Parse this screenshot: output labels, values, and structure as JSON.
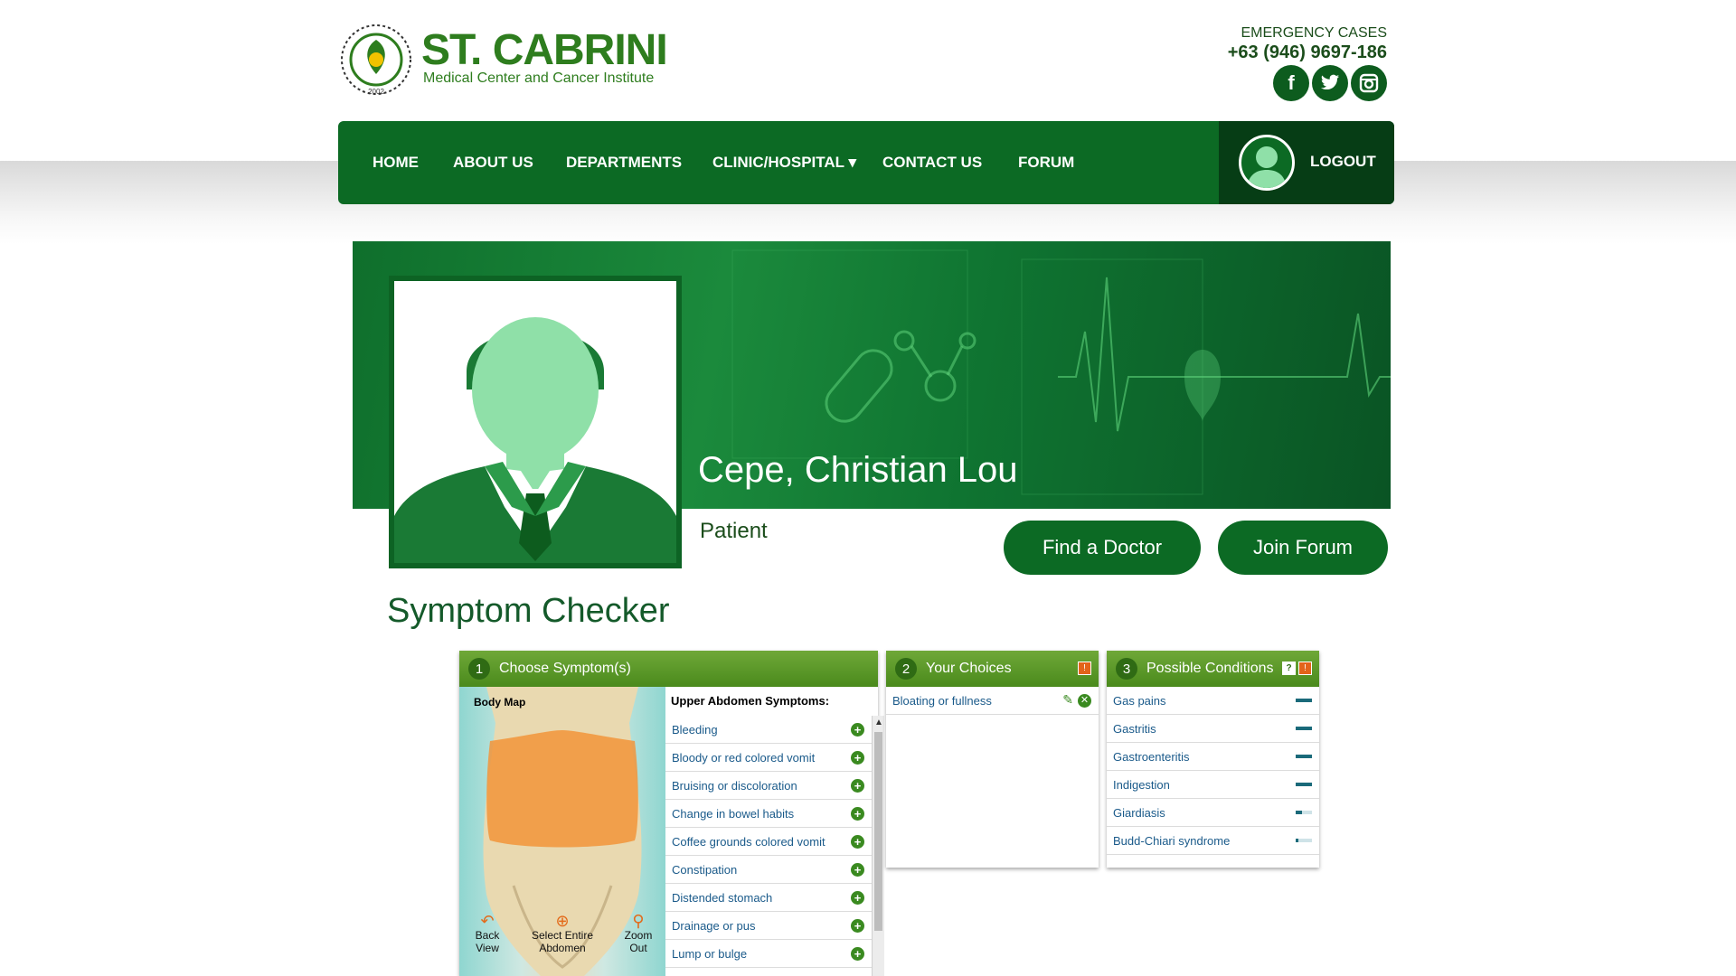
{
  "brand": {
    "name": "ST. CABRINI",
    "subtitle": "Medical Center and Cancer Institute",
    "logo_year": "2002"
  },
  "emergency": {
    "label": "EMERGENCY CASES",
    "phone": "+63 (946) 9697-186"
  },
  "social": [
    {
      "icon": "facebook-icon",
      "glyph": "f"
    },
    {
      "icon": "twitter-icon",
      "glyph": "t"
    },
    {
      "icon": "instagram-icon",
      "glyph": "◎"
    }
  ],
  "nav": {
    "items": [
      "HOME",
      "ABOUT US",
      "DEPARTMENTS",
      "CLINIC/HOSPITAL",
      "CONTACT US",
      "FORUM"
    ],
    "dropdown_caret": "▾",
    "logout": "LOGOUT"
  },
  "profile": {
    "name": "Cepe, Christian Lou",
    "role": "Patient"
  },
  "buttons": {
    "find_doctor": "Find a Doctor",
    "join_forum": "Join Forum"
  },
  "checker": {
    "title": "Symptom Checker",
    "step1": {
      "num": "1",
      "label": "Choose Symptom(s)",
      "bodymap_label": "Body Map",
      "controls": [
        "Back View",
        "Select Entire Abdomen",
        "Zoom Out"
      ],
      "list_title": "Upper Abdomen Symptoms:",
      "symptoms": [
        "Bleeding",
        "Bloody or red colored vomit",
        "Bruising or discoloration",
        "Change in bowel habits",
        "Coffee grounds colored vomit",
        "Constipation",
        "Distended stomach",
        "Drainage or pus",
        "Lump or bulge"
      ]
    },
    "step2": {
      "num": "2",
      "label": "Your Choices",
      "badge": "!",
      "choices": [
        "Bloating or fullness"
      ]
    },
    "step3": {
      "num": "3",
      "label": "Possible Conditions",
      "badges": [
        "?",
        "!"
      ],
      "conditions": [
        {
          "name": "Gas pains",
          "likelihood": 1.0
        },
        {
          "name": "Gastritis",
          "likelihood": 1.0
        },
        {
          "name": "Gastroenteritis",
          "likelihood": 1.0
        },
        {
          "name": "Indigestion",
          "likelihood": 1.0
        },
        {
          "name": "Giardiasis",
          "likelihood": 0.4
        },
        {
          "name": "Budd-Chiari syndrome",
          "likelihood": 0.15
        }
      ]
    }
  },
  "colors": {
    "brand_green": "#0c6a24",
    "dark_green": "#063d15",
    "header_green": "#4a8a1c",
    "link_blue": "#1a5a8a"
  }
}
